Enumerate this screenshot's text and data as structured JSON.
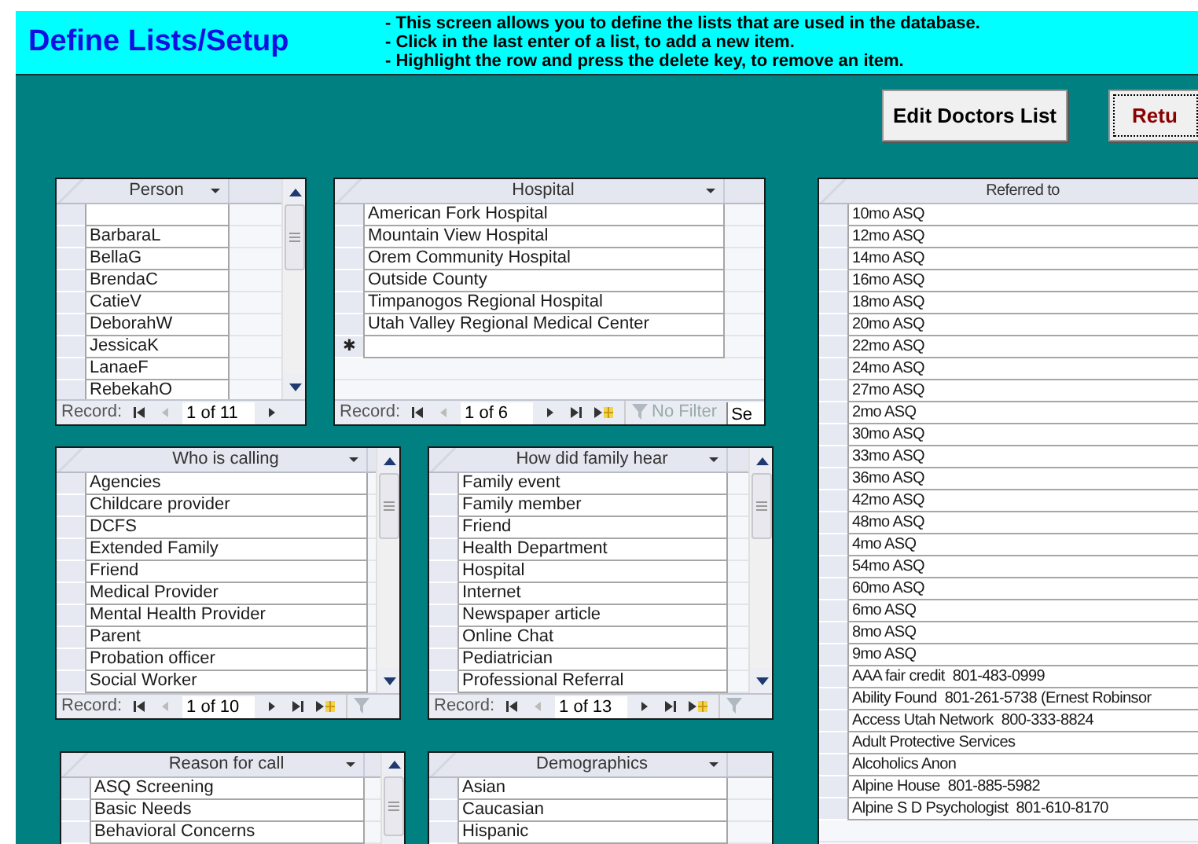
{
  "header": {
    "title": "Define Lists/Setup",
    "instructions": [
      "- This screen allows you to define the lists that are used in the database.",
      "- Click in the last enter of a list, to add a new item.",
      "- Highlight the row and press the delete key, to remove an item."
    ]
  },
  "buttons": [
    {
      "label": "Edit Doctors List",
      "kind": "normal"
    },
    {
      "label": "Retu",
      "kind": "focused"
    }
  ],
  "lists": [
    {
      "column": "Person",
      "dropdown": true,
      "scrollbar": true,
      "rows": [
        {
          "kind": "blank"
        },
        {
          "text": "BarbaraL"
        },
        {
          "text": "BellaG"
        },
        {
          "text": "BrendaC"
        },
        {
          "text": "CatieV"
        },
        {
          "text": "DeborahW"
        },
        {
          "text": "JessicaK"
        },
        {
          "text": "LanaeF"
        },
        {
          "text": "RebekahO"
        }
      ],
      "nav": {
        "label": "Record:",
        "position": "1 of 11",
        "controls": [
          {
            "kind": "first",
            "disabled": false
          },
          {
            "kind": "prev",
            "disabled": true
          },
          {
            "kind": "next",
            "disabled": false
          }
        ]
      }
    },
    {
      "column": "Hospital",
      "dropdown": true,
      "scrollbar": false,
      "rows": [
        {
          "text": "American Fork Hospital"
        },
        {
          "text": "Mountain View Hospital"
        },
        {
          "text": "Orem Community Hospital"
        },
        {
          "text": "Outside County"
        },
        {
          "text": "Timpanogos Regional Hospital"
        },
        {
          "text": "Utah Valley Regional Medical Center"
        },
        {
          "kind": "new",
          "marker": "✱"
        }
      ],
      "nav": {
        "label": "Record:",
        "position": "1 of 6",
        "controls": [
          {
            "kind": "first",
            "disabled": false
          },
          {
            "kind": "prev",
            "disabled": true
          },
          {
            "kind": "next",
            "disabled": false
          },
          {
            "kind": "last",
            "disabled": false
          },
          {
            "kind": "new",
            "disabled": false
          }
        ],
        "filter": {
          "label": "No Filter",
          "disabled": true
        },
        "search": "Se"
      }
    },
    {
      "column": "Who is calling",
      "dropdown": true,
      "scrollbar": true,
      "rows": [
        {
          "text": "Agencies"
        },
        {
          "text": "Childcare provider"
        },
        {
          "text": "DCFS"
        },
        {
          "text": "Extended Family"
        },
        {
          "text": "Friend"
        },
        {
          "text": "Medical Provider"
        },
        {
          "text": "Mental Health Provider"
        },
        {
          "text": "Parent"
        },
        {
          "text": "Probation officer"
        },
        {
          "text": "Social Worker"
        }
      ],
      "nav": {
        "label": "Record:",
        "position": "1 of 10",
        "controls": [
          {
            "kind": "first",
            "disabled": false
          },
          {
            "kind": "prev",
            "disabled": true
          },
          {
            "kind": "next",
            "disabled": false
          },
          {
            "kind": "last",
            "disabled": false
          },
          {
            "kind": "new",
            "disabled": false
          }
        ],
        "filter": {
          "disabled": true
        }
      }
    },
    {
      "column": "How did family hear",
      "dropdown": true,
      "scrollbar": true,
      "rows": [
        {
          "text": "Family event"
        },
        {
          "text": "Family member"
        },
        {
          "text": "Friend"
        },
        {
          "text": "Health Department"
        },
        {
          "text": "Hospital"
        },
        {
          "text": "Internet"
        },
        {
          "text": "Newspaper article"
        },
        {
          "text": "Online Chat"
        },
        {
          "text": "Pediatrician"
        },
        {
          "text": "Professional Referral"
        }
      ],
      "nav": {
        "label": "Record:",
        "position": "1 of 13",
        "controls": [
          {
            "kind": "first",
            "disabled": false
          },
          {
            "kind": "prev",
            "disabled": true
          },
          {
            "kind": "next",
            "disabled": false
          },
          {
            "kind": "last",
            "disabled": false
          },
          {
            "kind": "new",
            "disabled": false
          }
        ],
        "filter": {
          "disabled": true
        }
      }
    },
    {
      "column": "Reason for call",
      "dropdown": true,
      "scrollbar": true,
      "rows": [
        {
          "text": "ASQ Screening"
        },
        {
          "text": "Basic Needs"
        },
        {
          "text": "Behavioral Concerns"
        }
      ]
    },
    {
      "column": "Demographics",
      "dropdown": true,
      "scrollbar": false,
      "rows": [
        {
          "text": "Asian"
        },
        {
          "text": "Caucasian"
        },
        {
          "text": "Hispanic"
        }
      ]
    },
    {
      "column": "Referred to",
      "dropdown": false,
      "scrollbar": false,
      "rows": [
        {
          "text": "10mo ASQ"
        },
        {
          "text": "12mo ASQ"
        },
        {
          "text": "14mo ASQ"
        },
        {
          "text": "16mo ASQ"
        },
        {
          "text": "18mo ASQ"
        },
        {
          "text": "20mo ASQ"
        },
        {
          "text": "22mo ASQ"
        },
        {
          "text": "24mo ASQ"
        },
        {
          "text": "27mo ASQ"
        },
        {
          "text": "2mo ASQ"
        },
        {
          "text": "30mo ASQ"
        },
        {
          "text": "33mo ASQ"
        },
        {
          "text": "36mo ASQ"
        },
        {
          "text": "42mo ASQ"
        },
        {
          "text": "48mo ASQ"
        },
        {
          "text": "4mo ASQ"
        },
        {
          "text": "54mo ASQ"
        },
        {
          "text": "60mo ASQ"
        },
        {
          "text": "6mo ASQ"
        },
        {
          "text": "8mo ASQ"
        },
        {
          "text": "9mo ASQ"
        },
        {
          "text": "AAA fair credit  801-483-0999"
        },
        {
          "text": "Ability Found  801-261-5738 (Ernest Robinsor"
        },
        {
          "text": "Access Utah Network  800-333-8824"
        },
        {
          "text": "Adult Protective Services"
        },
        {
          "text": "Alcoholics Anon"
        },
        {
          "text": "Alpine House  801-885-5982"
        },
        {
          "text": "Alpine S D Psychologist  801-610-8170"
        }
      ]
    }
  ]
}
